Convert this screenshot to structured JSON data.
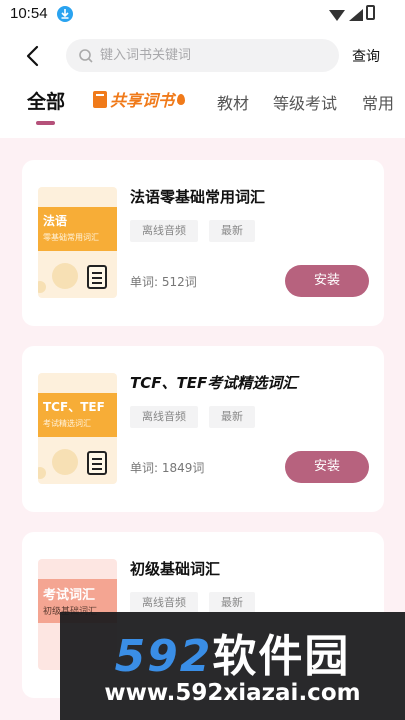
{
  "status_bar": {
    "time": "10:54"
  },
  "search": {
    "placeholder": "键入词书关键词",
    "value": "",
    "query_label": "查询"
  },
  "tabs": {
    "all": "全部",
    "shared": "共享词书",
    "items": [
      "教材",
      "等级考试",
      "常用"
    ]
  },
  "books": [
    {
      "title": "法语零基础常用词汇",
      "cover_title": "法语",
      "cover_subtitle": "零基础常用词汇",
      "tags": [
        "离线音频",
        "最新"
      ],
      "count": "单词: 512词",
      "action": "安装"
    },
    {
      "title": "TCF、TEF考试精选词汇",
      "cover_title": "TCF、TEF",
      "cover_subtitle": "考试精选词汇",
      "tags": [
        "离线音频",
        "最新"
      ],
      "count": "单词: 1849词",
      "action": "安装"
    },
    {
      "title": "初级基础词汇",
      "cover_title": "考试词汇",
      "cover_subtitle": "初级基础词汇",
      "tags": [
        "离线音频",
        "最新"
      ],
      "count": "",
      "action": ""
    }
  ],
  "watermark": {
    "digits": "592",
    "name": "软件园",
    "url": "www.592xiazai.com"
  },
  "colors": {
    "accent": "#b7627e",
    "shared_orange": "#f07a1a",
    "list_bg": "#fdf1f4"
  }
}
